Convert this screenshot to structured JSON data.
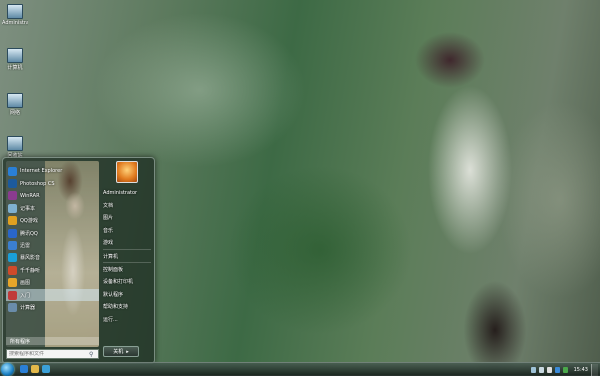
{
  "desktop": {
    "icons": [
      {
        "label": "Administra...",
        "icon": "user-folder-icon"
      },
      {
        "label": "计算机",
        "icon": "computer-icon"
      },
      {
        "label": "网络",
        "icon": "network-icon"
      },
      {
        "label": "回收站",
        "icon": "recycle-bin-icon"
      }
    ]
  },
  "start_menu": {
    "programs": [
      {
        "label": "Internet Explorer",
        "icon": "ie-icon",
        "color": "#2a7fd6"
      },
      {
        "label": "Photoshop CS",
        "icon": "photoshop-icon",
        "color": "#1c5a9c"
      },
      {
        "label": "WinRAR",
        "icon": "winrar-icon",
        "color": "#8a3b8f"
      },
      {
        "label": "记事本",
        "icon": "notepad-icon",
        "color": "#7fb0d0"
      },
      {
        "label": "QQ游戏",
        "icon": "qq-game-icon",
        "color": "#e0a020"
      },
      {
        "label": "腾讯QQ",
        "icon": "qq-icon",
        "color": "#2a66c9"
      },
      {
        "label": "迅雷",
        "icon": "xunlei-icon",
        "color": "#3b7fd0"
      },
      {
        "label": "暴风影音",
        "icon": "player-icon",
        "color": "#1a9fd8"
      },
      {
        "label": "千千静听",
        "icon": "music-icon",
        "color": "#d04a2a"
      },
      {
        "label": "画图",
        "icon": "paint-icon",
        "color": "#e6a52a"
      },
      {
        "label": "入门",
        "icon": "getting-started-icon",
        "color": "#c03a3a"
      },
      {
        "label": "计算器",
        "icon": "calculator-icon",
        "color": "#6a8caa"
      }
    ],
    "all_programs": "所有程序",
    "search_placeholder": "搜索程序和文件",
    "right_items": [
      "Administrator",
      "文档",
      "图片",
      "音乐",
      "游戏",
      "计算机",
      "控制面板",
      "设备和打印机",
      "默认程序",
      "帮助和支持",
      "运行..."
    ],
    "shutdown_label": "关机"
  },
  "taskbar": {
    "clock": "15:43",
    "quick_launch": [
      {
        "icon": "ie-icon",
        "color": "#2a7fd6"
      },
      {
        "icon": "explorer-icon",
        "color": "#e2b84a"
      },
      {
        "icon": "media-player-icon",
        "color": "#3ba0d8"
      }
    ],
    "tray_icons": [
      {
        "icon": "network-tray-icon",
        "color": "#9fc3d8"
      },
      {
        "icon": "volume-tray-icon",
        "color": "#c8d8e0"
      },
      {
        "icon": "flag-tray-icon",
        "color": "#e0e0e0"
      },
      {
        "icon": "qq-tray-icon",
        "color": "#3a8ad8"
      },
      {
        "icon": "shield-tray-icon",
        "color": "#4aa84a"
      }
    ]
  }
}
